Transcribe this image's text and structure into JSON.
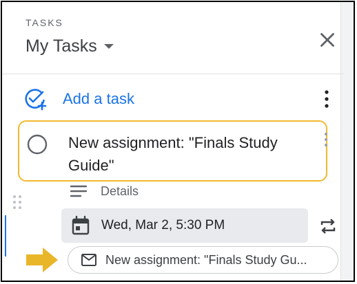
{
  "header": {
    "label": "TASKS",
    "list_title": "My Tasks"
  },
  "actions": {
    "add_task_label": "Add a task"
  },
  "task": {
    "title": "New assignment: \"Finals Study Guide\"",
    "details_label": "Details",
    "due_date": "Wed, Mar 2, 5:30 PM",
    "linked_email": "New assignment: \"Finals Study Gu..."
  },
  "icons": {
    "list_dropdown": "caret-down-icon",
    "close": "close-icon",
    "add_task": "add-task-icon",
    "more": "more-vert-icon",
    "checkbox": "circle-checkbox-icon",
    "details": "notes-icon",
    "calendar": "calendar-icon",
    "repeat": "repeat-icon",
    "email": "mail-icon",
    "pointer": "arrow-right-icon"
  },
  "colors": {
    "accent": "#1a73e8",
    "highlight_border": "#f2b92c",
    "pointer_arrow": "#e9b62a"
  }
}
